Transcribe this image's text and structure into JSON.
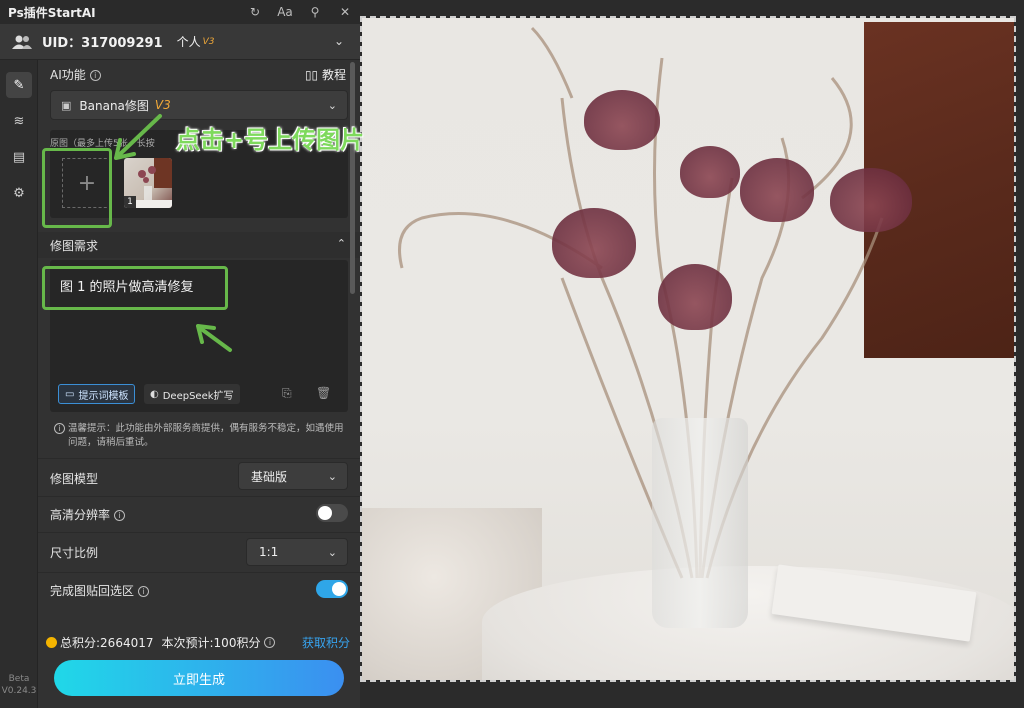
{
  "titlebar": {
    "title": "Ps插件StartAI",
    "icons": [
      "refresh-icon",
      "font-size-icon",
      "pin-icon",
      "close-icon"
    ],
    "font_label": "Aa"
  },
  "user": {
    "uid": "UID：317009291",
    "plan": "个人",
    "plan_tag": "V3"
  },
  "ai_function": {
    "label": "AI功能",
    "tutorial": "教程",
    "selected": "Banana修图",
    "tag": "V3"
  },
  "image_section": {
    "label": "原图（最多上传5张，长按",
    "thumb_index": "1"
  },
  "requirements": {
    "label": "修图需求",
    "prompt": "图 1 的照片做高清修复",
    "template_btn": "提示词模板",
    "deepseek_btn": "DeepSeek扩写"
  },
  "notice": "温馨提示：此功能由外部服务商提供，偶有服务不稳定，如遇使用问题，请稍后重试。",
  "settings": {
    "model_label": "修图模型",
    "model_value": "基础版",
    "hd_label": "高清分辨率",
    "hd_on": false,
    "ratio_label": "尺寸比例",
    "ratio_value": "1:1",
    "paste_label": "完成图贴回选区",
    "paste_on": true
  },
  "footer": {
    "points": "总积分:2664017",
    "cost": "本次预计:100积分",
    "get_points": "获取积分",
    "generate": "立即生成"
  },
  "version": {
    "beta": "Beta",
    "ver": "V0.24.3"
  },
  "annotation": {
    "upload_hint": "点击+号上传图片"
  },
  "colors": {
    "accent": "#2fa6e8",
    "annotation": "#67b84a",
    "vtag": "#f0a838"
  }
}
